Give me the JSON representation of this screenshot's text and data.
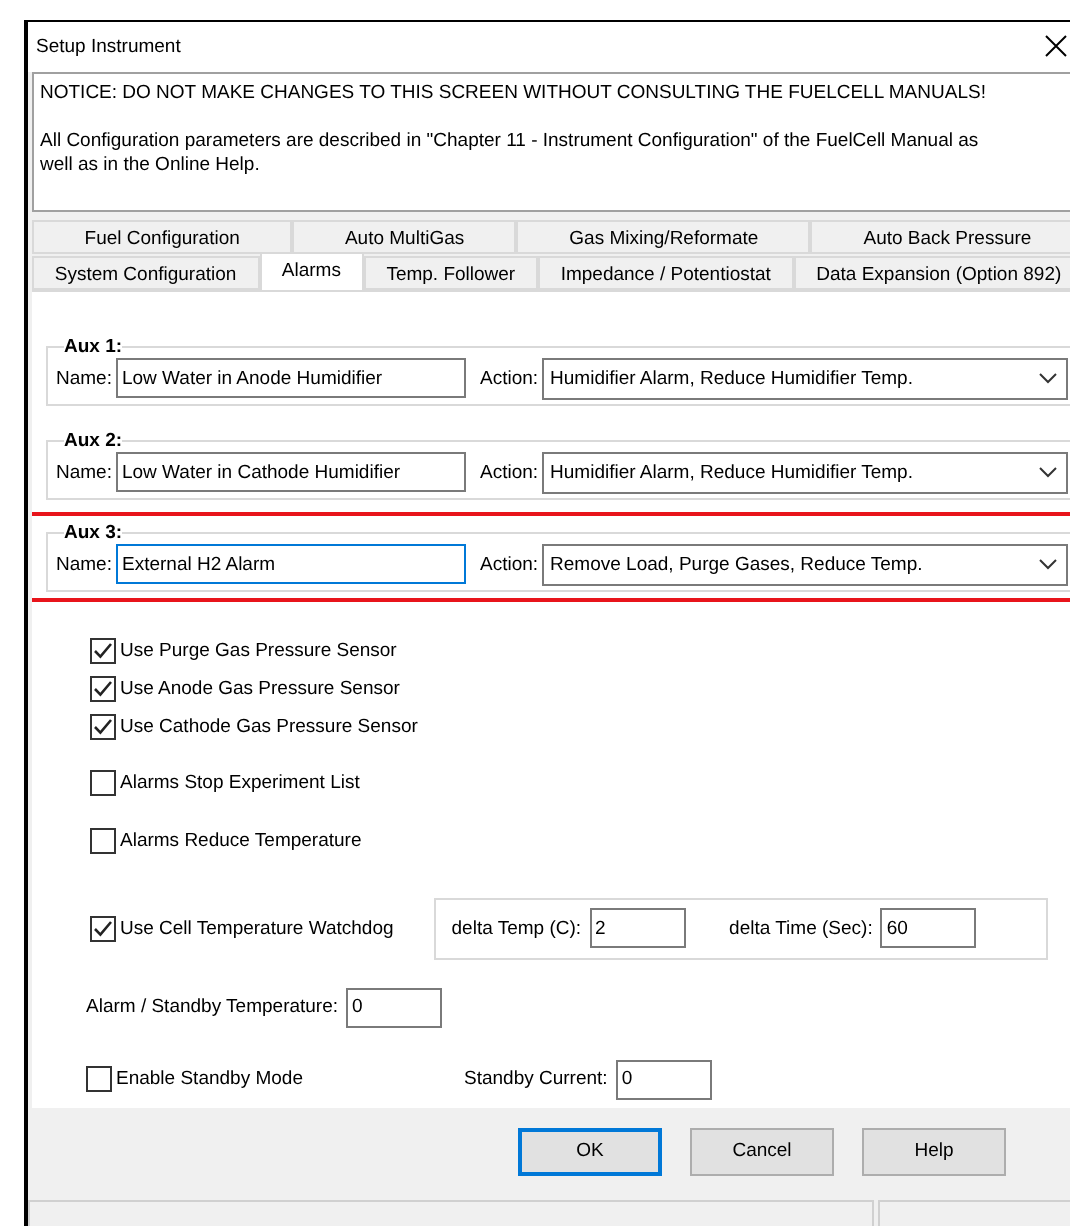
{
  "window": {
    "title": "Setup Instrument"
  },
  "notice": {
    "warning": "NOTICE:  DO NOT MAKE CHANGES TO THIS SCREEN WITHOUT CONSULTING THE FUELCELL MANUALS!",
    "info": "All Configuration parameters are described in \"Chapter 11 - Instrument Configuration\" of the FuelCell Manual as well as in the Online Help."
  },
  "tab_rows": [
    [
      {
        "label": "Fuel Configuration",
        "selected": false
      },
      {
        "label": "Auto MultiGas",
        "selected": false
      },
      {
        "label": "Gas Mixing/Reformate",
        "selected": false
      },
      {
        "label": "Auto Back Pressure",
        "selected": false
      }
    ],
    [
      {
        "label": "System Configuration",
        "selected": false
      },
      {
        "label": "Alarms",
        "selected": true
      },
      {
        "label": "Temp. Follower",
        "selected": false
      },
      {
        "label": "Impedance / Potentiostat",
        "selected": false
      },
      {
        "label": "Data Expansion (Option 892)",
        "selected": false
      }
    ]
  ],
  "aux_groups": [
    {
      "label": "Aux 1:",
      "name_label": "Name:",
      "name_value": "Low Water in Anode Humidifier",
      "name_focused": false,
      "action_label": "Action:",
      "action_value": "Humidifier Alarm, Reduce Humidifier Temp.",
      "highlighted": false
    },
    {
      "label": "Aux 2:",
      "name_label": "Name:",
      "name_value": "Low Water in Cathode Humidifier",
      "name_focused": false,
      "action_label": "Action:",
      "action_value": "Humidifier Alarm, Reduce Humidifier Temp.",
      "highlighted": false
    },
    {
      "label": "Aux 3:",
      "name_label": "Name:",
      "name_value": "External H2 Alarm",
      "name_focused": true,
      "action_label": "Action:",
      "action_value": "Remove Load, Purge Gases, Reduce Temp.",
      "highlighted": true
    }
  ],
  "sensor_checkboxes": [
    {
      "label": "Use Purge Gas Pressure Sensor",
      "checked": true
    },
    {
      "label": "Use Anode Gas Pressure Sensor",
      "checked": true
    },
    {
      "label": "Use Cathode Gas Pressure Sensor",
      "checked": true
    }
  ],
  "alarm_options": [
    {
      "label": "Alarms Stop Experiment List",
      "checked": false
    },
    {
      "label": "Alarms Reduce Temperature",
      "checked": false
    }
  ],
  "watchdog": {
    "checkbox": {
      "label": "Use Cell Temperature Watchdog",
      "checked": true
    },
    "delta_temp": {
      "label": "delta Temp (C):",
      "value": "2"
    },
    "delta_time": {
      "label": "delta Time (Sec):",
      "value": "60"
    }
  },
  "standby_temperature": {
    "label": "Alarm / Standby Temperature:",
    "value": "0"
  },
  "standby_mode": {
    "label": "Enable Standby Mode",
    "checked": false
  },
  "standby_current": {
    "label": "Standby Current:",
    "value": "0"
  },
  "buttons": [
    {
      "label": "OK",
      "default": true
    },
    {
      "label": "Cancel",
      "default": false
    },
    {
      "label": "Help",
      "default": false
    }
  ]
}
